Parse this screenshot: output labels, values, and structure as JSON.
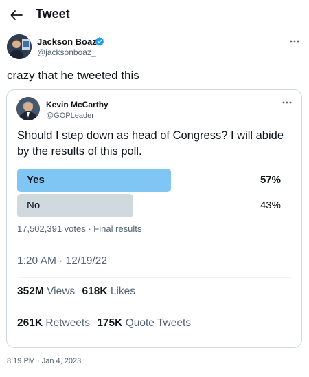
{
  "header": {
    "title": "Tweet"
  },
  "tweet": {
    "author_name": "Jackson Boaz",
    "author_handle": "@jacksonboaz_",
    "text": "crazy that he tweeted this",
    "timestamp": "8:19 PM · Jan 4, 2023"
  },
  "quote": {
    "author_name": "Kevin McCarthy",
    "author_handle": "@GOPLeader",
    "text": "Should I step down as head of Congress? I will abide by the results of this poll.",
    "poll": {
      "options": [
        {
          "label": "Yes",
          "percent_label": "57%",
          "share": 0.57,
          "leading": true
        },
        {
          "label": "No",
          "percent_label": "43%",
          "share": 0.43,
          "leading": false
        }
      ],
      "meta": "17,502,391 votes · Final results"
    },
    "time": "1:20 AM · 12/19/22",
    "views_count": "352M",
    "views_label": "Views",
    "likes_count": "618K",
    "likes_label": "Likes",
    "retweets_count": "261K",
    "retweets_label": "Retweets",
    "quote_tweets_count": "175K",
    "quote_tweets_label": "Quote Tweets"
  },
  "colors": {
    "poll_leading": "#7fc6f4",
    "poll_other": "#cfd9de",
    "verified": "#1d9bf0",
    "secondary_text": "#536471"
  },
  "icons": {
    "back": "arrow-left-icon",
    "verified": "verified-badge-icon",
    "more": "more-horizontal-icon"
  }
}
